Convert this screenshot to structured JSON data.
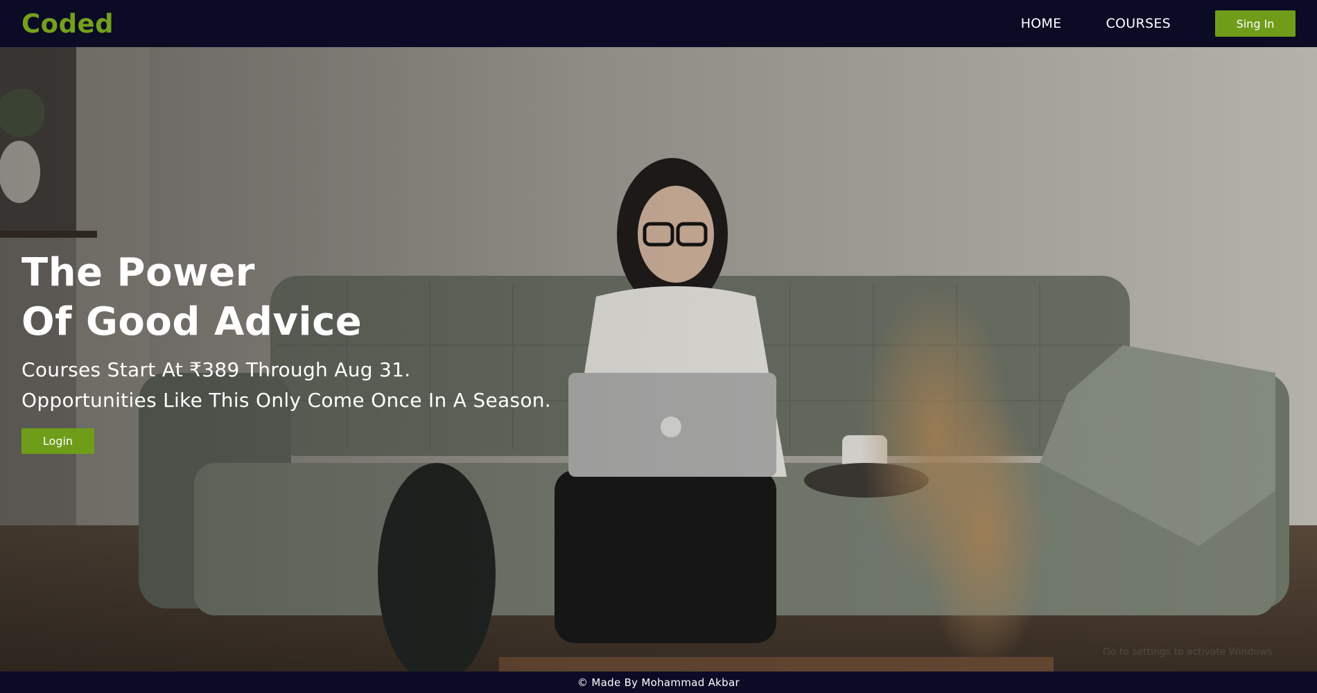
{
  "brand": {
    "name": "Coded",
    "color": "#74a01c"
  },
  "nav": {
    "links": [
      {
        "label": "HOME"
      },
      {
        "label": "COURSES"
      }
    ],
    "signin_label": "Sing In"
  },
  "hero": {
    "title_line1": "The Power",
    "title_line2": "Of Good Advice",
    "subtitle_line1": "Courses Start At ₹389 Through Aug 31.",
    "subtitle_line2": "Opportunities Like This Only Come Once In A Season.",
    "login_label": "Login",
    "background_image": "woman-on-sofa-with-laptop-photo",
    "watermark": "Go to settings to activate Windows."
  },
  "footer": {
    "text": "© Made By Mohammad Akbar"
  },
  "colors": {
    "nav_bg": "#0b0b26",
    "accent": "#6f9d1a"
  }
}
